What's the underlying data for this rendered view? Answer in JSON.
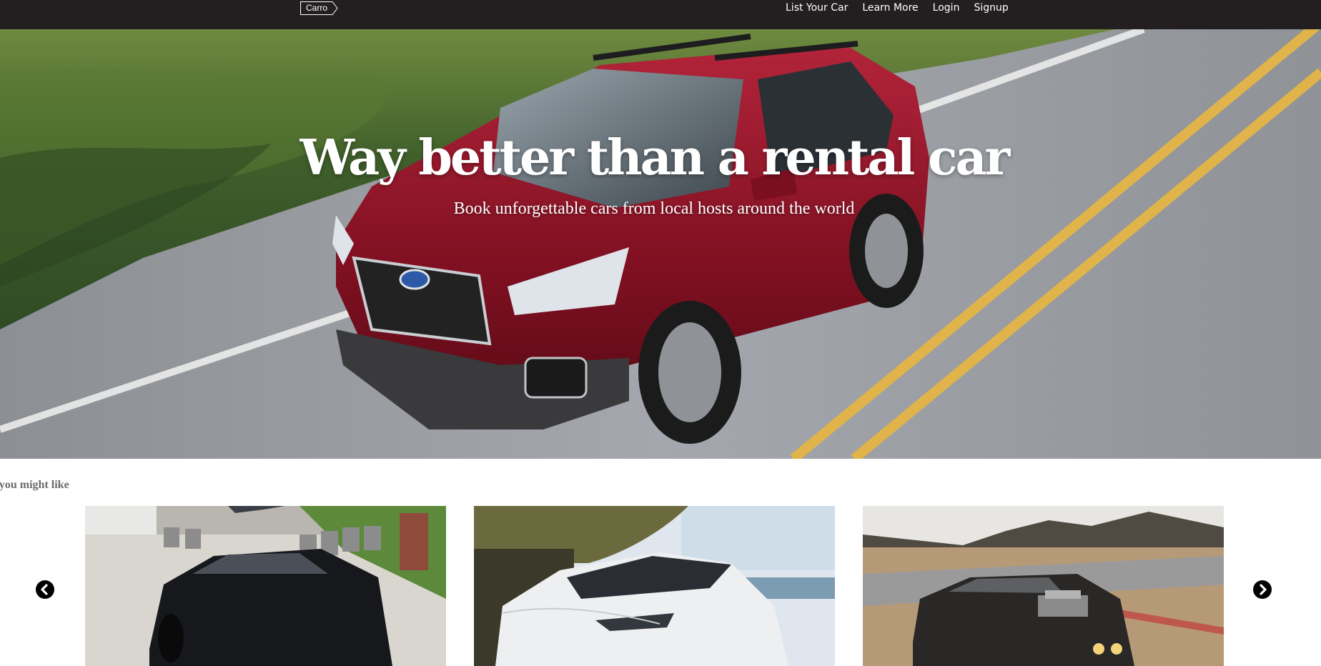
{
  "navbar": {
    "logo_text": "Carro",
    "links": [
      "List Your Car",
      "Learn More",
      "Login",
      "Signup"
    ]
  },
  "hero": {
    "title": "Way better than a rental car",
    "subtitle": "Book unforgettable cars from local hosts around the world"
  },
  "recommendations": {
    "heading": "Cars you might like",
    "cards": [
      {
        "image": "black-camaro-photo"
      },
      {
        "image": "white-tesla-suv-photo"
      },
      {
        "image": "black-muscle-car-photo"
      }
    ],
    "prev_icon": "chevron-left-icon",
    "next_icon": "chevron-right-icon"
  },
  "colors": {
    "navbar_bg": "#231f20",
    "nav_text": "#ffffff",
    "hero_text": "#ffffff",
    "heading_text": "#6b6b6b"
  }
}
